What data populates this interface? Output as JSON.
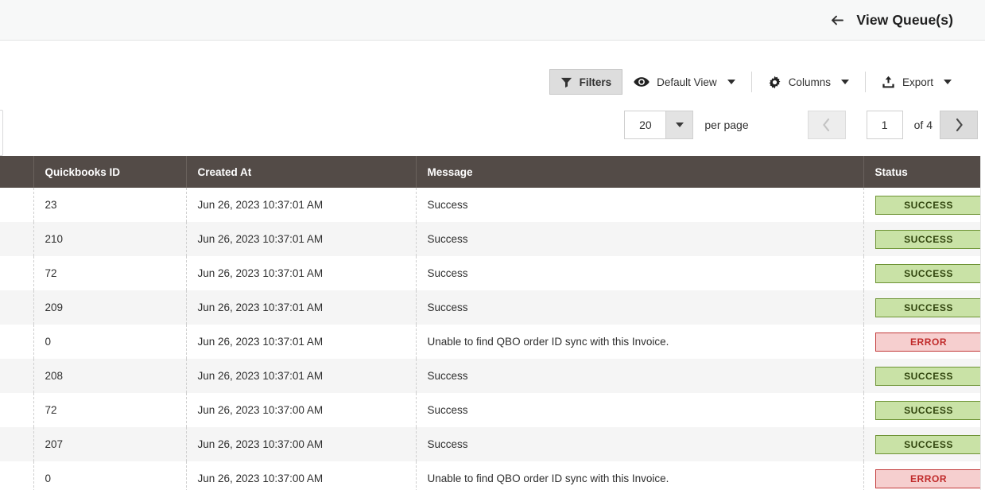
{
  "header": {
    "back_icon": "arrow-left-icon",
    "title": "View Queue(s)"
  },
  "toolbar": {
    "filters": {
      "label": "Filters",
      "icon": "funnel-icon",
      "active": true
    },
    "view": {
      "label": "Default View",
      "icon": "eye-icon"
    },
    "columns": {
      "label": "Columns",
      "icon": "gear-icon"
    },
    "export": {
      "label": "Export",
      "icon": "upload-icon"
    }
  },
  "pagination": {
    "per_page_value": "20",
    "per_page_label": "per page",
    "prev_icon": "chevron-left-icon",
    "next_icon": "chevron-right-icon",
    "current_page": "1",
    "of_label": "of 4"
  },
  "table": {
    "columns": [
      {
        "key": "select",
        "label": ""
      },
      {
        "key": "quickbooks_id",
        "label": "Quickbooks ID"
      },
      {
        "key": "created_at",
        "label": "Created At"
      },
      {
        "key": "message",
        "label": "Message"
      },
      {
        "key": "status",
        "label": "Status"
      }
    ],
    "rows": [
      {
        "quickbooks_id": "23",
        "created_at": "Jun 26, 2023 10:37:01 AM",
        "message": "Success",
        "status": "SUCCESS"
      },
      {
        "quickbooks_id": "210",
        "created_at": "Jun 26, 2023 10:37:01 AM",
        "message": "Success",
        "status": "SUCCESS"
      },
      {
        "quickbooks_id": "72",
        "created_at": "Jun 26, 2023 10:37:01 AM",
        "message": "Success",
        "status": "SUCCESS"
      },
      {
        "quickbooks_id": "209",
        "created_at": "Jun 26, 2023 10:37:01 AM",
        "message": "Success",
        "status": "SUCCESS"
      },
      {
        "quickbooks_id": "0",
        "created_at": "Jun 26, 2023 10:37:01 AM",
        "message": "Unable to find QBO order ID sync with this Invoice.",
        "status": "ERROR"
      },
      {
        "quickbooks_id": "208",
        "created_at": "Jun 26, 2023 10:37:01 AM",
        "message": "Success",
        "status": "SUCCESS"
      },
      {
        "quickbooks_id": "72",
        "created_at": "Jun 26, 2023 10:37:00 AM",
        "message": "Success",
        "status": "SUCCESS"
      },
      {
        "quickbooks_id": "207",
        "created_at": "Jun 26, 2023 10:37:00 AM",
        "message": "Success",
        "status": "SUCCESS"
      },
      {
        "quickbooks_id": "0",
        "created_at": "Jun 26, 2023 10:37:00 AM",
        "message": "Unable to find QBO order ID sync with this Invoice.",
        "status": "ERROR"
      }
    ]
  },
  "colors": {
    "header_row_bg": "#534b47",
    "success_bg": "#c9e2a6",
    "success_border": "#6d9334",
    "error_bg": "#f6cfcf",
    "error_border": "#c33b3b",
    "topbar_bg": "#f7f8f8"
  }
}
